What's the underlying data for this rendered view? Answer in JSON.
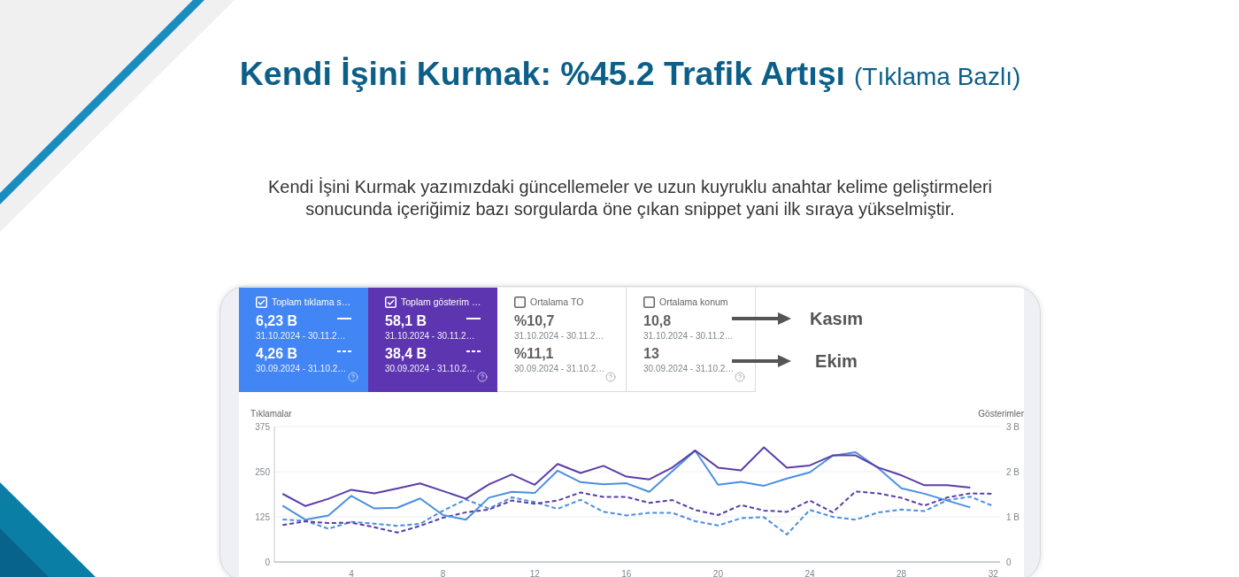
{
  "title": {
    "main": "Kendi İşini Kurmak: %45.2 Trafik Artışı",
    "note": "(Tıklama Bazlı)"
  },
  "description": "Kendi İşini Kurmak yazımızdaki güncellemeler ve uzun kuyruklu anahtar kelime geliştirmeleri sonucunda içeriğimiz bazı sorgularda öne çıkan snippet yani ilk sıraya yükselmiştir.",
  "report": {
    "metrics": [
      {
        "title": "Toplam tıklama s…",
        "checked": true,
        "color": "#4285f4",
        "current": {
          "value": "6,23 B",
          "range": "31.10.2024 - 30.11.2…"
        },
        "previous": {
          "value": "4,26 B",
          "range": "30.09.2024 - 31.10.2…"
        }
      },
      {
        "title": "Toplam gösterim …",
        "checked": true,
        "color": "#5e35b1",
        "current": {
          "value": "58,1 B",
          "range": "31.10.2024 - 30.11.2…"
        },
        "previous": {
          "value": "38,4 B",
          "range": "30.09.2024 - 31.10.2…"
        }
      },
      {
        "title": "Ortalama TO",
        "checked": false,
        "current": {
          "value": "%10,7",
          "range": "31.10.2024 - 30.11.2…"
        },
        "previous": {
          "value": "%11,1",
          "range": "30.09.2024 - 31.10.2…"
        }
      },
      {
        "title": "Ortalama konum",
        "checked": false,
        "current": {
          "value": "10,8",
          "range": "31.10.2024 - 30.11.2…"
        },
        "previous": {
          "value": "13",
          "range": "30.09.2024 - 31.10.2…"
        }
      }
    ],
    "callouts": [
      {
        "label": "Kasım"
      },
      {
        "label": "Ekim"
      }
    ],
    "chart_data": {
      "type": "line",
      "ylabel": "Tıklamalar",
      "y2label": "Gösterimler",
      "x": [
        1,
        2,
        3,
        4,
        5,
        6,
        7,
        8,
        9,
        10,
        11,
        12,
        13,
        14,
        15,
        16,
        17,
        18,
        19,
        20,
        21,
        22,
        23,
        24,
        25,
        26,
        27,
        28,
        29,
        30,
        31,
        32
      ],
      "xlim": [
        0.64,
        32.3
      ],
      "ylim": [
        0,
        375
      ],
      "y2lim": [
        0,
        3
      ],
      "xticks": [
        4,
        8,
        12,
        16,
        20,
        24,
        28,
        32
      ],
      "yticks": [
        0,
        125,
        250,
        375
      ],
      "y2ticks": [
        {
          "value": 0,
          "label": "0"
        },
        {
          "value": 1,
          "label": "1 B"
        },
        {
          "value": 2,
          "label": "2 B"
        },
        {
          "value": 3,
          "label": "3 B"
        }
      ],
      "series": [
        {
          "color": "#4a8fe0",
          "line_style": "dashed",
          "values": [
            118,
            114,
            92,
            111,
            106,
            100,
            106,
            142,
            173,
            148,
            179,
            166,
            147,
            172,
            139,
            129,
            136,
            136,
            113,
            101,
            121,
            124,
            76,
            144,
            125,
            117,
            137,
            145,
            141,
            171,
            181,
            155
          ]
        },
        {
          "color": "#5b3da8",
          "line_style": "dashed",
          "axis": "y2",
          "values": [
            0.82,
            0.9,
            0.86,
            0.87,
            0.77,
            0.65,
            0.8,
            0.98,
            1.1,
            1.16,
            1.36,
            1.29,
            1.36,
            1.54,
            1.44,
            1.44,
            1.31,
            1.37,
            1.15,
            1.04,
            1.26,
            1.14,
            1.11,
            1.36,
            1.1,
            1.56,
            1.52,
            1.42,
            1.25,
            1.43,
            1.52,
            1.51
          ]
        },
        {
          "color": "#4a8fe0",
          "values": [
            156,
            117,
            129,
            183,
            148,
            150,
            176,
            130,
            117,
            178,
            194,
            191,
            253,
            221,
            215,
            218,
            194,
            251,
            308,
            214,
            222,
            211,
            231,
            248,
            294,
            304,
            259,
            204,
            189,
            170,
            151,
            null
          ]
        },
        {
          "color": "#5b3da8",
          "axis": "y2",
          "values": [
            1.51,
            1.24,
            1.4,
            1.6,
            1.52,
            1.63,
            1.74,
            1.57,
            1.4,
            1.72,
            1.94,
            1.71,
            2.17,
            1.97,
            2.13,
            1.89,
            1.83,
            2.09,
            2.47,
            2.09,
            2.03,
            2.54,
            2.09,
            2.14,
            2.36,
            2.36,
            2.09,
            1.92,
            1.7,
            1.7,
            1.65,
            null
          ]
        }
      ]
    }
  }
}
